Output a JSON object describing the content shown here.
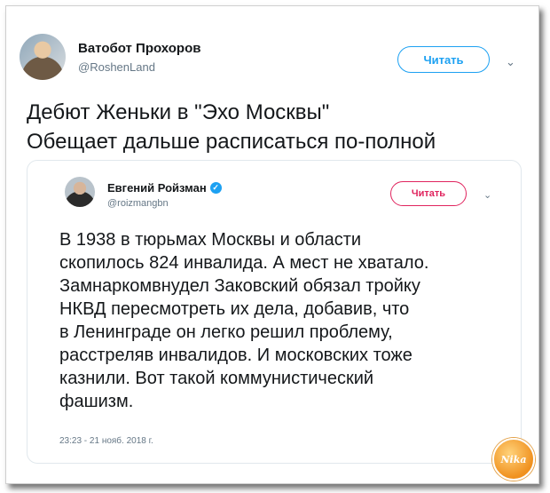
{
  "outer_tweet": {
    "author_name": "Ватобот Прохоров",
    "author_handle": "@RoshenLand",
    "follow_label": "Читать",
    "text_line1": "Дебют Женьки в \"Эхо Москвы\"",
    "text_line2": "Обещает дальше расписаться по-полной"
  },
  "quoted_tweet": {
    "author_name": "Евгений Ройзман",
    "author_handle": "@roizmangbn",
    "follow_label": "Читать",
    "text": "В 1938 в тюрьмах Москвы и области\nскопилось 824 инвалида. А мест не хватало.\nЗамнаркомвнудел Заковский обязал тройку\nНКВД пересмотреть  их дела, добавив, что\nв Ленинграде он легко решил проблему,\nрасстреляв инвалидов. И московских тоже\nказнили. Вот такой коммунистический\nфашизм.",
    "timestamp": "23:23 - 21 нояб. 2018 г."
  },
  "watermark": {
    "text": "Nika"
  },
  "icons": {
    "verified": "verified-badge-icon",
    "chevron": "chevron-down-icon"
  },
  "colors": {
    "twitter_blue": "#1da1f2",
    "follow_inner_red": "#e0245e",
    "text": "#14171a",
    "muted": "#657786"
  }
}
